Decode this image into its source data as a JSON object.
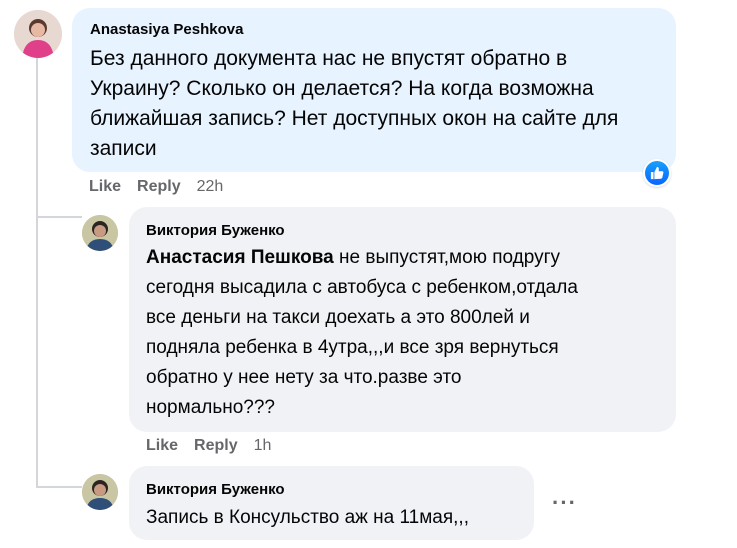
{
  "comments": [
    {
      "author": "Anastasiya Peshkova",
      "text": "Без данного документа нас не впустят обратно в Украину? Сколько он делается? На когда возможна ближайшая запись? Нет доступных окон на сайте для записи",
      "lines": [
        "Без данного документа нас не впустят обратно в",
        "Украину? Сколько он делается? На когда возможна",
        "ближайшая запись? Нет доступных окон на сайте для",
        "записи"
      ],
      "like_label": "Like",
      "reply_label": "Reply",
      "time": "22h",
      "reaction_icon": "like-reaction-icon"
    },
    {
      "author": "Виктория Буженко",
      "mention": "Анастасия Пешкова",
      "lines": [
        " не выпустят,мою подругу",
        "сегодня высадила с автобуса с ребенком,отдала",
        "все деньги на такси доехать а это 800лей и",
        "подняла ребенка в 4утра,,,и все зря вернуться",
        "обратно у нее нету за что.разве это",
        "нормально???"
      ],
      "like_label": "Like",
      "reply_label": "Reply",
      "time": "1h"
    },
    {
      "author": "Виктория Буженко",
      "text": "Запись в Консульство аж на 11мая,,,",
      "more_label": "···"
    }
  ],
  "colors": {
    "blue_bubble": "#e7f3ff",
    "grey_bubble": "#f0f2f5",
    "meta_text": "#65676b",
    "like_blue": "#0866ff"
  }
}
